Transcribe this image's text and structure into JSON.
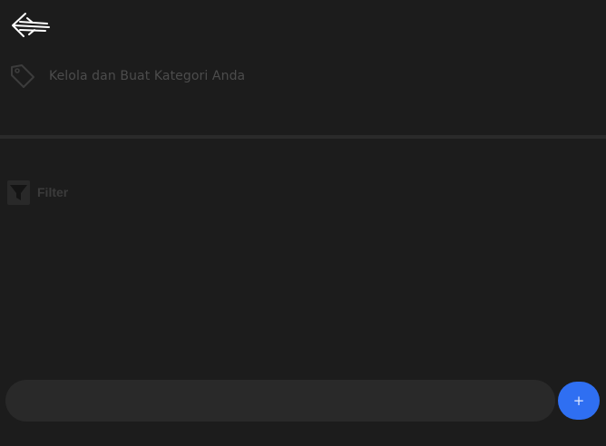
{
  "header": {
    "back_icon": "arrow-left-icon",
    "tag_icon": "tag-icon",
    "title": "Kelola dan Buat Kategori Anda"
  },
  "filter": {
    "icon": "funnel-icon",
    "label": "Filter"
  },
  "composer": {
    "input_value": "",
    "placeholder": "",
    "add_label": "+"
  },
  "colors": {
    "background": "#1c1c1c",
    "accent": "#2f6ff2"
  }
}
